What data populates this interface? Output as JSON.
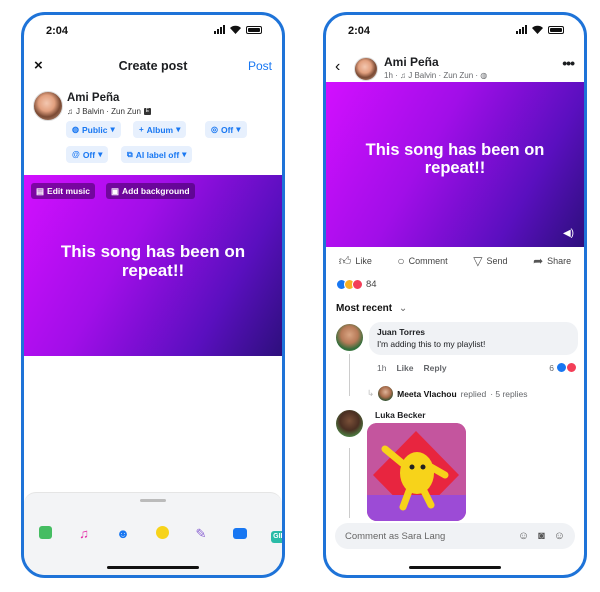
{
  "status_bar": {
    "time": "2:04"
  },
  "create_post": {
    "close_icon": "×",
    "title": "Create post",
    "post_label": "Post",
    "author_name": "Ami Peña",
    "song": "J Balvin · Zun Zun",
    "explicit_badge": "E",
    "chips": [
      {
        "label": "Public",
        "icon": "globe-icon"
      },
      {
        "label": "Album",
        "icon": "plus-icon"
      },
      {
        "label": "Off",
        "icon": "instagram-icon"
      },
      {
        "label": "Off",
        "icon": "threads-icon"
      },
      {
        "label": "AI label off",
        "icon": "ai-label-icon"
      }
    ],
    "edit_music_label": "Edit music",
    "add_background_label": "Add background",
    "post_text": "This song has been on repeat!!",
    "toolbar_icons": [
      "photo-icon",
      "music-icon",
      "tag-people-icon",
      "feeling-icon",
      "pencil-icon",
      "camera-icon",
      "gif-icon"
    ],
    "gif_label": "GIF"
  },
  "feed_post": {
    "author_name": "Ami Peña",
    "meta": "1h · ♫ J Balvin · Zun Zun ·",
    "post_text": "This song has been on repeat!!",
    "actions": {
      "like": "Like",
      "comment": "Comment",
      "send": "Send",
      "share": "Share"
    },
    "reaction_count": "84",
    "sort_label": "Most recent",
    "comments": [
      {
        "name": "Juan Torres",
        "text": "I'm adding this to my playlist!",
        "time": "1h",
        "like": "Like",
        "reply": "Reply",
        "reactions": "6"
      }
    ],
    "reply_summary": {
      "name": "Meeta Vlachou",
      "action": "replied",
      "count": "· 5 replies"
    },
    "second_comment_name": "Luka Becker",
    "comment_placeholder": "Comment as Sara Lang"
  },
  "colors": {
    "accent": "#1877f2",
    "frame": "#1e73d8",
    "gradient_start": "#d30fff",
    "gradient_end": "#2d0f7c"
  }
}
